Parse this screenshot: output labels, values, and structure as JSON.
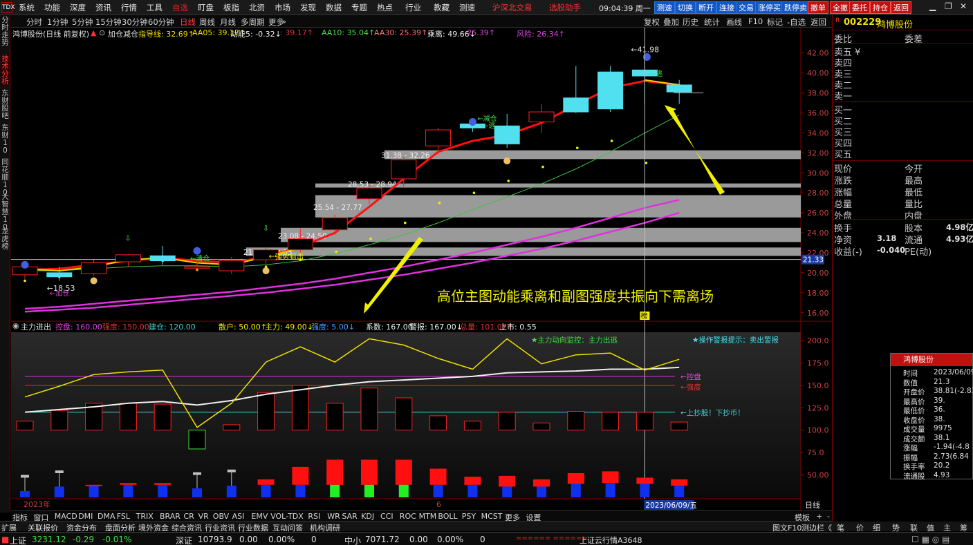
{
  "menubar": {
    "logo": "TDX",
    "items": [
      "系统",
      "功能",
      "深度",
      "资讯",
      "行情",
      "工具",
      "自选",
      "盯盘",
      "板指",
      "北资",
      "市场",
      "发现",
      "数据",
      "专题",
      "热点",
      "行业",
      "教藏",
      "测速"
    ],
    "promo": [
      "沪深北交易",
      "选股助手"
    ],
    "clock": "09:04:39 周一",
    "toolbar": [
      "测速",
      "切换",
      "断开",
      "连接",
      "交易",
      "涨停买",
      "跌停卖",
      "撤单",
      "全撤",
      "委托",
      "持仓",
      "返回"
    ]
  },
  "periods": {
    "items": [
      "分时",
      "1分钟",
      "5分钟",
      "15分钟",
      "30分钟",
      "60分钟",
      "日线",
      "周线",
      "月线",
      "多周期",
      "更多"
    ],
    "selected": "日线",
    "right": [
      "复权",
      "叠加",
      "历史",
      "统计",
      "画线",
      "F10",
      "标记",
      "-自选",
      "返回"
    ]
  },
  "left_tabs": [
    {
      "label": "分时走势",
      "selected": false
    },
    {
      "label": "技术分析",
      "selected": true
    },
    {
      "label": "东财股吧",
      "selected": false
    },
    {
      "label": "东财10",
      "selected": false
    },
    {
      "label": "同花顺10",
      "selected": false
    },
    {
      "label": "大智慧10",
      "selected": false
    },
    {
      "label": "龙虎榜",
      "selected": false
    }
  ],
  "title_row": {
    "stock": "鸿博股份(日线 前复权)",
    "mode": "加仓减仓",
    "items": [
      {
        "text": "指导线: 32.69↑",
        "color": "#f0e000"
      },
      {
        "text": "AA05: 39.17↑",
        "color": "#f0e000"
      },
      {
        "text": "动能5: -0.32↓",
        "color": "#f0f0f0"
      },
      {
        "text": ": 39.17↑",
        "color": "#e03030"
      },
      {
        "text": "AA10: 35.04↑",
        "color": "#40e040"
      },
      {
        "text": "AA30: 25.39↑",
        "color": "#ff7070"
      },
      {
        "text": "乘离: 49.66↓",
        "color": "#f0f0f0"
      },
      {
        "text": ": 25.39↑",
        "color": "#e040e0"
      },
      {
        "text": "风险: 26.34↑",
        "color": "#e040e0"
      }
    ]
  },
  "subchart_title": {
    "name": "主力进出",
    "items": [
      {
        "text": "控盘: 160.00",
        "color": "#e040e0"
      },
      {
        "text": "强度: 150.00",
        "color": "#e03030"
      },
      {
        "text": "建仓: 120.00",
        "color": "#40d0d0"
      },
      {
        "text": "散户: 50.00↑",
        "color": "#f0f000"
      },
      {
        "text": "主力: 49.00↓",
        "color": "#f0f000"
      },
      {
        "text": "强度: 5.00↓",
        "color": "#40a0ff"
      },
      {
        "text": "系数: 167.00",
        "color": "#f0f0f0"
      },
      {
        "text": "警报: 167.00↓",
        "color": "#f0f0f0"
      },
      {
        "text": "总量: 101.07↑",
        "color": "#e03030"
      },
      {
        "text": "上市: 0.55",
        "color": "#f0f0f0"
      }
    ]
  },
  "price_axis": [
    "42.00",
    "40.00",
    "38.00",
    "36.00",
    "34.00",
    "32.00",
    "30.00",
    "28.00",
    "26.00",
    "24.00",
    "22.00",
    "20.00",
    "18.00",
    "16.00"
  ],
  "price_marker": "21.33",
  "sub_axis": [
    "200.0",
    "175.0",
    "150.0",
    "125.0",
    "100.0",
    "75.0",
    "50.00"
  ],
  "chart_labels": {
    "high": "41.98",
    "low": "18.53",
    "zones": [
      "31.38 - 32.26",
      "28.53 - 28.94",
      "25.54 - 27.77",
      "23.08 - 24.50",
      "21.69 - 22.53"
    ],
    "signals": [
      "加仓",
      "清仓",
      "强势狙击",
      "减仓",
      "逃",
      "逃"
    ],
    "sub_signals": [
      "★主力动向监控：主力出逃",
      "★操作警报提示：卖出警报"
    ],
    "sub_lines": [
      "←控盘",
      "←强度",
      "←上抄股！下抄币！"
    ],
    "date_start": "2023年",
    "date_mid": "6",
    "date_cursor": "2023/06/09/五",
    "cursor_tag": "榜",
    "annotation": "高位主图动能乘离和副图强度共振向下需离场"
  },
  "indicators": [
    "指标",
    "窗口",
    "MACD",
    "DMI",
    "DMA",
    "FSL",
    "TRIX",
    "BRAR",
    "CR",
    "VR",
    "OBV",
    "ASI",
    "EMV",
    "VOL-TDX",
    "RSI",
    "WR",
    "SAR",
    "KDJ",
    "CCI",
    "ROC",
    "MTM",
    "BOLL",
    "PSY",
    "MCST",
    "更多",
    "设置"
  ],
  "indicator_right": [
    "模板",
    "+",
    "-"
  ],
  "bottom_tabs": [
    "扩展",
    "关联报价",
    "资金分布",
    "盘面分析",
    "境外资金",
    "综合资讯",
    "行业资讯",
    "行业数据",
    "互动问答",
    "机构调研"
  ],
  "bottom_right": [
    "图文F10",
    "测边栏《",
    "笔",
    "价",
    "细",
    "势",
    "联",
    "值",
    "主",
    "筹"
  ],
  "statusbar": {
    "sh_name": "上证",
    "sh_val": "3231.12",
    "sh_chg": "-0.29",
    "sh_pct": "-0.01%",
    "sz_name": "深证",
    "sz_val": "10793.9",
    "sz_chg": "0.00",
    "sz_pct": "0.00%",
    "sz_vol": "0",
    "zx_name": "中小",
    "zx_val": "7071.72",
    "zx_chg": "0.00",
    "zx_pct": "0.00%",
    "zx_vol": "0",
    "ticker": "上证云行情A3648"
  },
  "rpanel": {
    "code": "002229",
    "name": "鸿博股份",
    "wb": "委比",
    "wc": "委差",
    "asks": [
      "卖五 ¥",
      "卖四",
      "卖三",
      "卖二",
      "卖一"
    ],
    "bids": [
      "买一",
      "买二",
      "买三",
      "买四",
      "买五"
    ],
    "left": [
      "现价",
      "涨跌",
      "涨幅",
      "总量",
      "外盘"
    ],
    "right": [
      "今开",
      "最高",
      "最低",
      "量比",
      "内盘"
    ],
    "rows": [
      {
        "l": "换手",
        "lv": "",
        "r": "股本",
        "rv": "4.98亿"
      },
      {
        "l": "净资",
        "lv": "3.18",
        "r": "流通",
        "rv": "4.93亿"
      },
      {
        "l": "收益(-)",
        "lv": "-0.040",
        "r": "PE(动)",
        "rv": ""
      }
    ]
  },
  "infobox": {
    "title": "鸿博股份",
    "rows": [
      {
        "k": "时间",
        "v": "2023/06/09/"
      },
      {
        "k": "数值",
        "v": "21.3"
      },
      {
        "k": "开盘价",
        "v": "38.81(-2.83"
      },
      {
        "k": "最高价",
        "v": "39."
      },
      {
        "k": "最低价",
        "v": "36."
      },
      {
        "k": "收盘价",
        "v": "38."
      },
      {
        "k": "成交量",
        "v": "9975"
      },
      {
        "k": "成交额",
        "v": "38.1"
      },
      {
        "k": "涨幅",
        "v": "-1.94(-4.8"
      },
      {
        "k": "振幅",
        "v": "2.73(6.84"
      },
      {
        "k": "换手率",
        "v": "20.2"
      },
      {
        "k": "流通股",
        "v": "4.93"
      }
    ]
  },
  "chart_data": {
    "type": "candlestick",
    "price_ylim": [
      15.5,
      43.5
    ],
    "candles": [
      {
        "o": 19.8,
        "h": 21.0,
        "l": 19.4,
        "c": 20.6
      },
      {
        "o": 20.0,
        "h": 20.6,
        "l": 19.2,
        "c": 19.6
      },
      {
        "o": 19.9,
        "h": 21.3,
        "l": 19.7,
        "c": 21.0
      },
      {
        "o": 21.1,
        "h": 21.9,
        "l": 20.6,
        "c": 21.8
      },
      {
        "o": 21.7,
        "h": 22.7,
        "l": 20.8,
        "c": 21.2
      },
      {
        "o": 20.5,
        "h": 21.2,
        "l": 20.2,
        "c": 20.6
      },
      {
        "o": 20.2,
        "h": 21.6,
        "l": 19.9,
        "c": 21.2
      },
      {
        "o": 21.3,
        "h": 22.6,
        "l": 20.9,
        "c": 22.3
      },
      {
        "o": 22.3,
        "h": 24.4,
        "l": 22.0,
        "c": 23.4
      },
      {
        "o": 24.3,
        "h": 25.8,
        "l": 23.8,
        "c": 25.5
      },
      {
        "o": 27.4,
        "h": 28.8,
        "l": 26.9,
        "c": 28.5
      },
      {
        "o": 29.4,
        "h": 31.6,
        "l": 28.6,
        "c": 31.3
      },
      {
        "o": 32.7,
        "h": 34.5,
        "l": 31.8,
        "c": 34.3
      },
      {
        "o": 34.9,
        "h": 35.2,
        "l": 34.1,
        "c": 34.5
      },
      {
        "o": 34.7,
        "h": 35.9,
        "l": 32.5,
        "c": 32.9
      },
      {
        "o": 35.1,
        "h": 36.9,
        "l": 34.0,
        "c": 36.1
      },
      {
        "o": 37.5,
        "h": 40.7,
        "l": 36.0,
        "c": 36.1
      },
      {
        "o": 40.1,
        "h": 40.7,
        "l": 36.1,
        "c": 36.4
      },
      {
        "o": 40.3,
        "h": 41.98,
        "l": 36.9,
        "c": 39.7
      },
      {
        "o": 38.8,
        "h": 39.3,
        "l": 36.9,
        "c": 38.1
      }
    ],
    "sub_ylim": [
      25,
      210
    ],
    "sub_yellow": [
      137,
      149,
      162,
      165,
      167,
      103,
      130,
      176,
      193,
      176,
      202,
      195,
      180,
      168,
      202,
      174,
      184,
      186,
      167,
      179
    ],
    "sub_white": [
      120,
      123,
      126,
      130,
      132,
      128,
      133,
      140,
      145,
      150,
      154,
      156,
      158,
      160,
      164,
      165,
      166,
      168,
      168,
      170
    ],
    "sub_bars": [
      {
        "t": 110,
        "b": 100,
        "up": true
      },
      {
        "t": 122,
        "b": 100,
        "up": true
      },
      {
        "t": 130,
        "b": 100,
        "up": true
      },
      {
        "t": 130,
        "b": 100,
        "up": true
      },
      {
        "t": 129,
        "b": 100,
        "up": true
      },
      {
        "t": 100,
        "b": 79,
        "up": false
      },
      {
        "t": 106,
        "b": 100,
        "up": true
      },
      {
        "t": 142,
        "b": 100,
        "up": true
      },
      {
        "t": 150,
        "b": 100,
        "up": true
      },
      {
        "t": 130,
        "b": 100,
        "up": true
      },
      {
        "t": 147,
        "b": 100,
        "up": true
      },
      {
        "t": 136,
        "b": 100,
        "up": true
      },
      {
        "t": 116,
        "b": 100,
        "up": true
      },
      {
        "t": 110,
        "b": 100,
        "up": true
      },
      {
        "t": 120,
        "b": 100,
        "up": true
      },
      {
        "t": 108,
        "b": 100,
        "up": true
      },
      {
        "t": 121,
        "b": 100,
        "up": true
      },
      {
        "t": 120,
        "b": 100,
        "up": true
      },
      {
        "t": 120,
        "b": 100,
        "up": true
      },
      {
        "t": 109,
        "b": 100,
        "up": true
      }
    ],
    "vol_blue": [
      32,
      37,
      38,
      39,
      39,
      35,
      38,
      39,
      39,
      39,
      39,
      39,
      39,
      39,
      37,
      37,
      40,
      41,
      40,
      38
    ],
    "vol_red_top": [
      null,
      null,
      39,
      41,
      41,
      null,
      null,
      45,
      59,
      67,
      67,
      67,
      57,
      48,
      49,
      45,
      52,
      54,
      47,
      45
    ],
    "vol_green": [
      0,
      0,
      0,
      0,
      0,
      0,
      0,
      0,
      0,
      40,
      40,
      40,
      0,
      0,
      0,
      0,
      0,
      0,
      0,
      0
    ]
  }
}
